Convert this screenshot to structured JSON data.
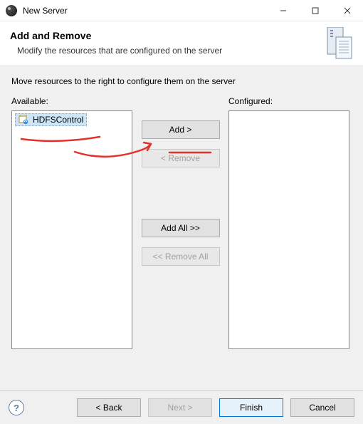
{
  "window": {
    "title": "New Server"
  },
  "banner": {
    "heading": "Add and Remove",
    "subtitle": "Modify the resources that are configured on the server"
  },
  "instruction": "Move resources to the right to configure them on the server",
  "labels": {
    "available": "Available:",
    "configured": "Configured:"
  },
  "available_items": [
    {
      "name": "HDFSControl"
    }
  ],
  "buttons": {
    "add": "Add >",
    "remove": "< Remove",
    "add_all": "Add All >>",
    "remove_all": "<< Remove All",
    "back": "< Back",
    "next": "Next >",
    "finish": "Finish",
    "cancel": "Cancel"
  }
}
